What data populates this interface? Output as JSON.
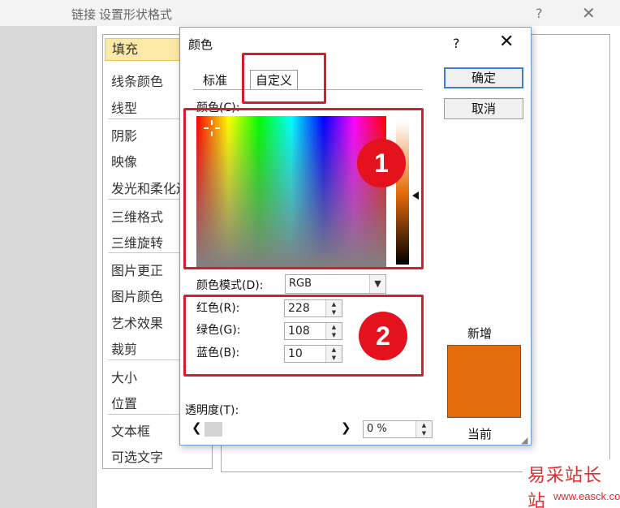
{
  "background_window": {
    "prefix_text": "链接",
    "title": "设置形状格式",
    "help": "?",
    "close": "✕",
    "sidebar": [
      "填充",
      "线条颜色",
      "线型",
      "阴影",
      "映像",
      "发光和柔化边",
      "三维格式",
      "三维旋转",
      "图片更正",
      "图片颜色",
      "艺术效果",
      "裁剪",
      "大小",
      "位置",
      "文本框",
      "可选文字"
    ]
  },
  "dialog": {
    "title": "颜色",
    "help": "?",
    "close": "✕",
    "tabs": {
      "standard": "标准",
      "custom": "自定义"
    },
    "ok_button": "确定",
    "cancel_button": "取消",
    "colors_label": "颜色(C):",
    "color_model_label": "颜色模式(D):",
    "color_model_value": "RGB",
    "red_label": "红色(R):",
    "red_value": "228",
    "green_label": "绿色(G):",
    "green_value": "108",
    "blue_label": "蓝色(B):",
    "blue_value": "10",
    "transparency_label": "透明度(T):",
    "transparency_value": "0 %",
    "new_label": "新增",
    "current_label": "当前",
    "new_color": "#e46c0a"
  },
  "annotations": {
    "badge1": "1",
    "badge2": "2",
    "accent_color": "#d21f2b"
  },
  "watermark": {
    "text": "易采站长站",
    "url": "www.easck.com"
  }
}
